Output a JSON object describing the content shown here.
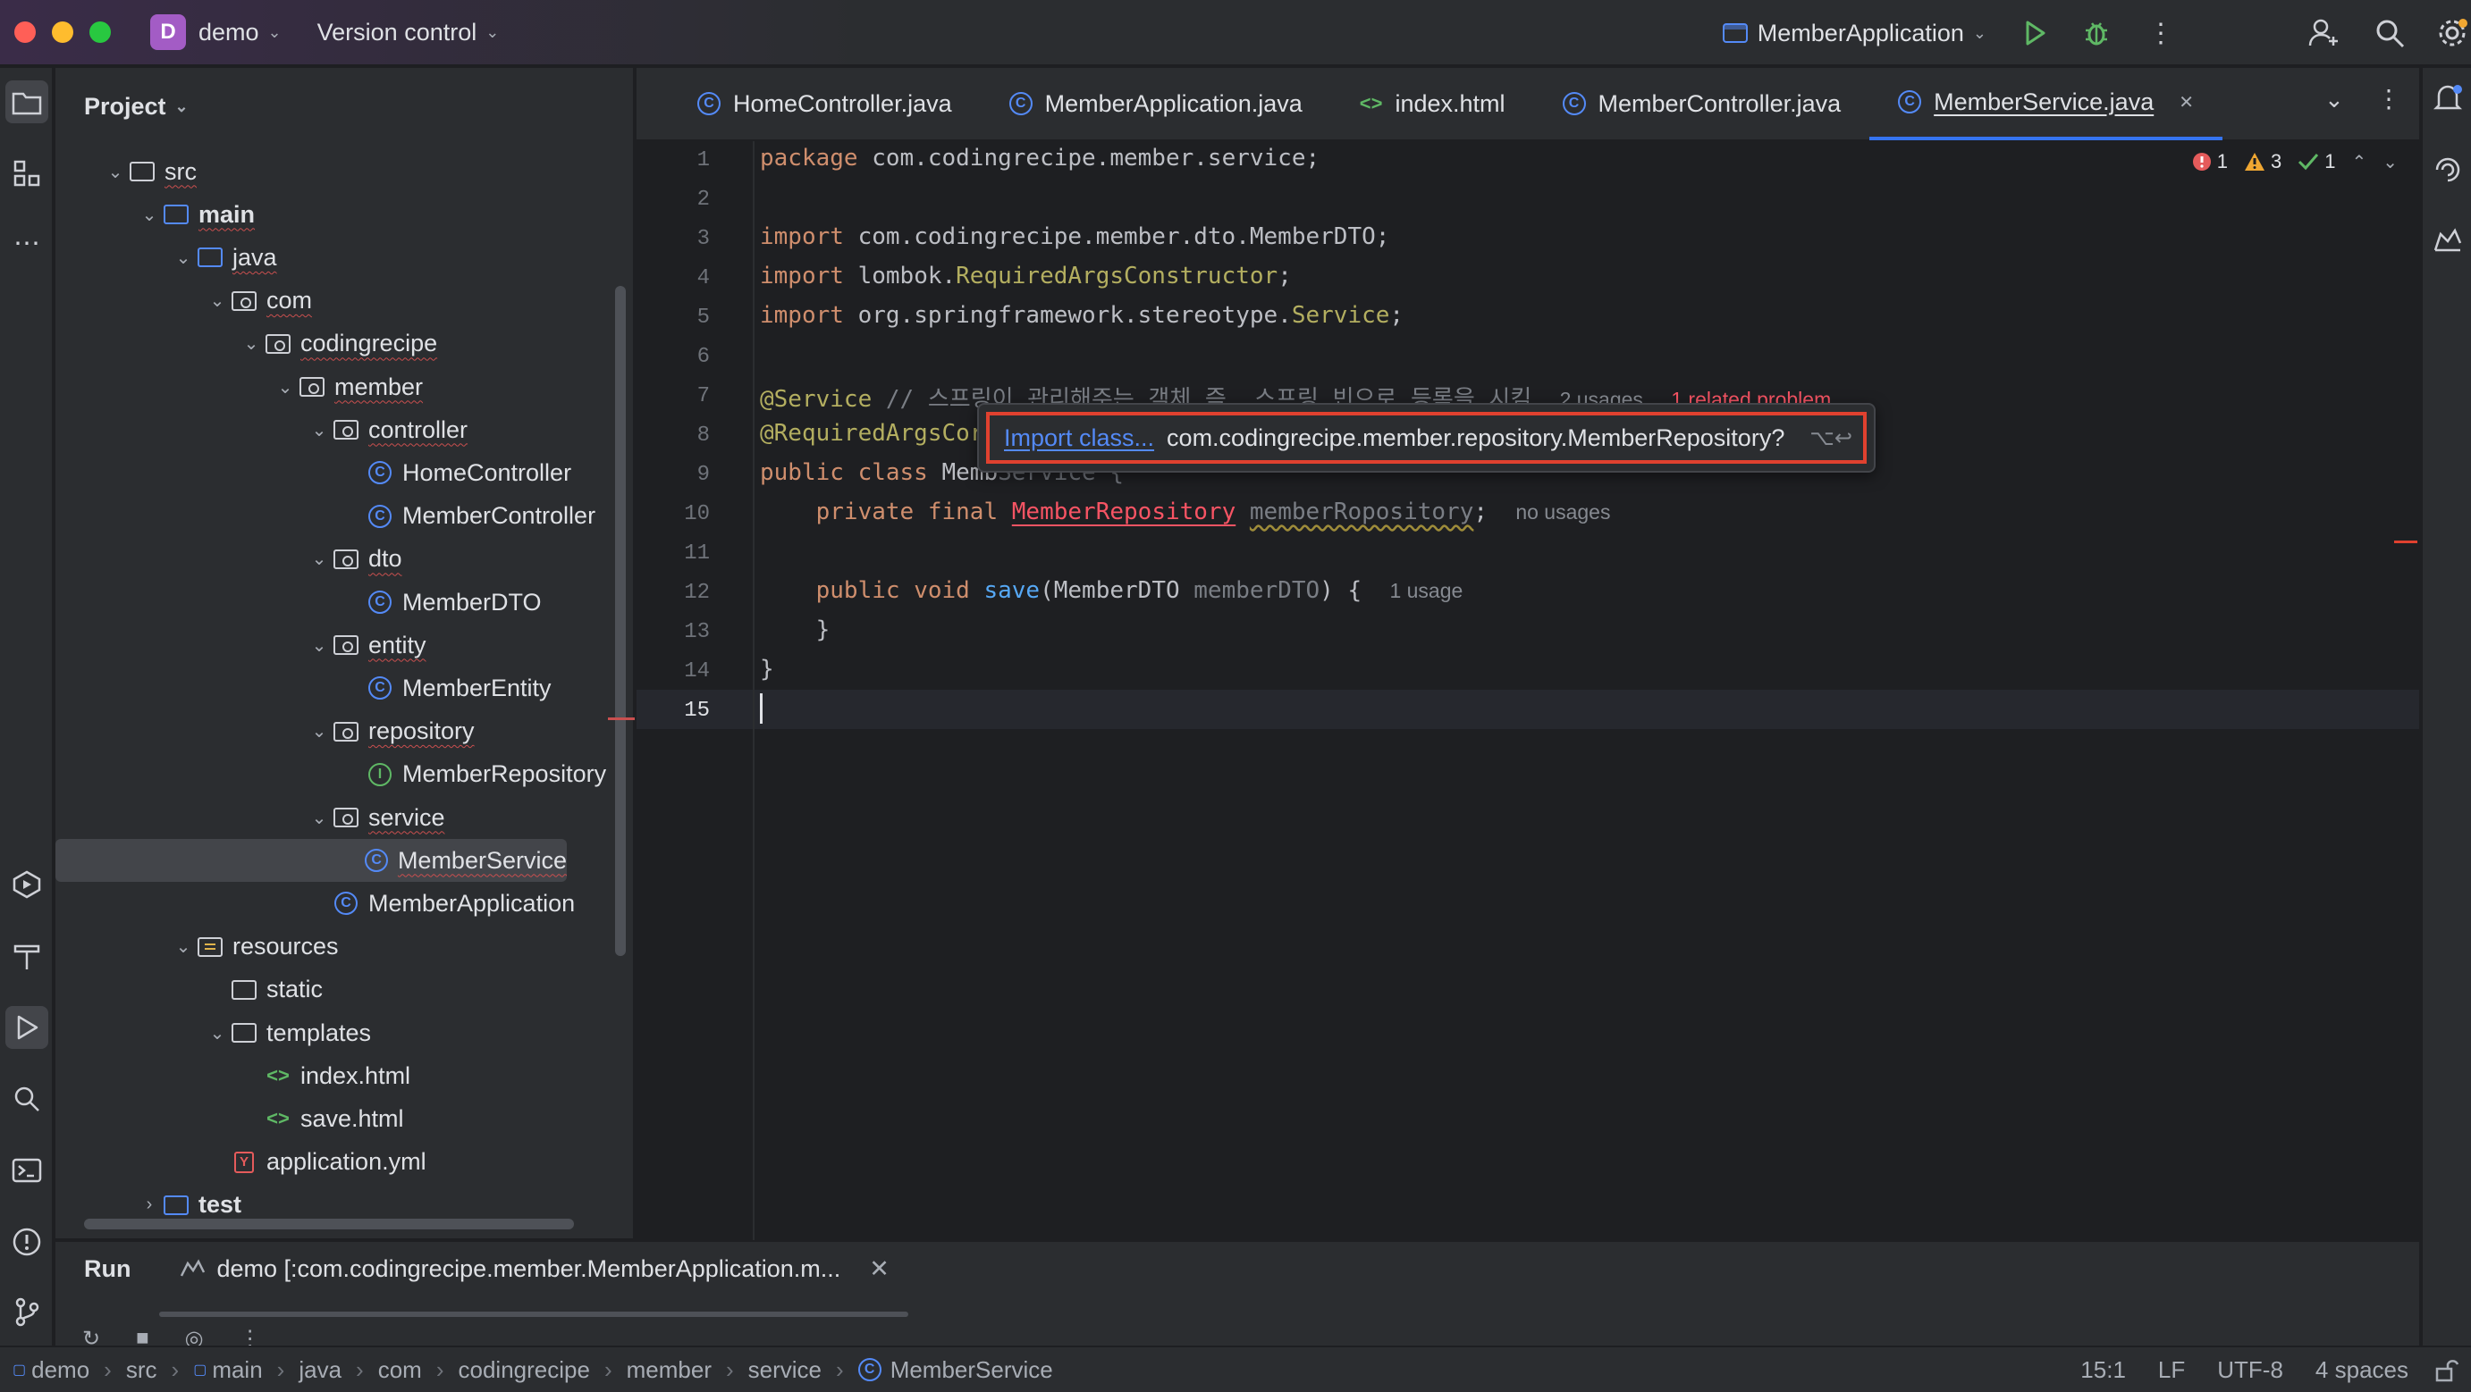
{
  "titlebar": {
    "project_badge": "D",
    "project_name": "demo",
    "vcs": "Version control",
    "run_config": "MemberApplication"
  },
  "project_panel": {
    "title": "Project",
    "tree": [
      {
        "label": "src",
        "kind": "folder",
        "depth": 0,
        "expanded": true
      },
      {
        "label": "main",
        "kind": "folder-src",
        "depth": 1,
        "expanded": true,
        "bold": true
      },
      {
        "label": "java",
        "kind": "folder-src",
        "depth": 2,
        "expanded": true
      },
      {
        "label": "com",
        "kind": "package",
        "depth": 3,
        "expanded": true
      },
      {
        "label": "codingrecipe",
        "kind": "package",
        "depth": 4,
        "expanded": true
      },
      {
        "label": "member",
        "kind": "package",
        "depth": 5,
        "expanded": true
      },
      {
        "label": "controller",
        "kind": "package",
        "depth": 6,
        "expanded": true
      },
      {
        "label": "HomeController",
        "kind": "class",
        "depth": 7
      },
      {
        "label": "MemberController",
        "kind": "class",
        "depth": 7
      },
      {
        "label": "dto",
        "kind": "package",
        "depth": 6,
        "expanded": true
      },
      {
        "label": "MemberDTO",
        "kind": "class",
        "depth": 7
      },
      {
        "label": "entity",
        "kind": "package",
        "depth": 6,
        "expanded": true
      },
      {
        "label": "MemberEntity",
        "kind": "class",
        "depth": 7
      },
      {
        "label": "repository",
        "kind": "package",
        "depth": 6,
        "expanded": true
      },
      {
        "label": "MemberRepository",
        "kind": "interface",
        "depth": 7
      },
      {
        "label": "service",
        "kind": "package",
        "depth": 6,
        "expanded": true
      },
      {
        "label": "MemberService",
        "kind": "class",
        "depth": 7,
        "selected": true
      },
      {
        "label": "MemberApplication",
        "kind": "app",
        "depth": 6
      },
      {
        "label": "resources",
        "kind": "folder-res",
        "depth": 2,
        "expanded": true
      },
      {
        "label": "static",
        "kind": "folder",
        "depth": 3
      },
      {
        "label": "templates",
        "kind": "folder",
        "depth": 3,
        "expanded": true
      },
      {
        "label": "index.html",
        "kind": "html",
        "depth": 4
      },
      {
        "label": "save.html",
        "kind": "html",
        "depth": 4
      },
      {
        "label": "application.yml",
        "kind": "yml",
        "depth": 3
      },
      {
        "label": "test",
        "kind": "folder-src",
        "depth": 1,
        "expanded": false,
        "bold": true
      }
    ]
  },
  "tabs": [
    {
      "label": "HomeController.java",
      "icon": "class-icon"
    },
    {
      "label": "MemberApplication.java",
      "icon": "app-icon"
    },
    {
      "label": "index.html",
      "icon": "html-icon"
    },
    {
      "label": "MemberController.java",
      "icon": "class-icon"
    },
    {
      "label": "MemberService.java",
      "icon": "class-icon",
      "active": true
    }
  ],
  "editor": {
    "inspections": {
      "errors": "1",
      "warnings": "3",
      "ok": "1"
    },
    "current_line": "15",
    "lines": {
      "l1": {
        "a": "package",
        "b": " com.codingrecipe.member.service;"
      },
      "l3": {
        "a": "import",
        "b": " com.codingrecipe.member.dto.MemberDTO;"
      },
      "l4": {
        "a": "import",
        "b": " lombok.",
        "c": "RequiredArgsConstructor",
        "d": ";"
      },
      "l5": {
        "a": "import",
        "b": " org.springframework.stereotype.",
        "c": "Service",
        "d": ";"
      },
      "l7": {
        "a": "@Service",
        "b": " // 스프링이 관리해주는 객체 즉, 스프링 빈으로 등록을 시킴",
        "c": "2 usages",
        "d": "1 related problem"
      },
      "l8": {
        "a": "@RequiredArgsCor"
      },
      "l9": {
        "a": "public class",
        "b": " Memb",
        "c": "Service {"
      },
      "l10": {
        "a": "private final",
        "b": "MemberRepository",
        "c": "memberRopository",
        "d": ";",
        "e": "no usages"
      },
      "l12": {
        "a": "public void",
        "b": "save",
        "c": "(MemberDTO ",
        "d": "memberDTO",
        "e": ") {",
        "f": "1 usage"
      },
      "l13": {
        "a": "}"
      },
      "l14": {
        "a": "}"
      }
    }
  },
  "popup": {
    "link": "Import class...",
    "text": "com.codingrecipe.member.repository.MemberRepository?",
    "keys": "⌥↩"
  },
  "run_panel": {
    "title": "Run",
    "tab": "demo [:com.codingrecipe.member.MemberApplication.m..."
  },
  "statusbar": {
    "crumbs": [
      "demo",
      "src",
      "main",
      "java",
      "com",
      "codingrecipe",
      "member",
      "service",
      "MemberService"
    ],
    "position": "15:1",
    "line_sep": "LF",
    "encoding": "UTF-8",
    "indent": "4 spaces"
  },
  "colors": {
    "accent": "#3574f0",
    "error": "#f75464",
    "highlight_box": "#e0412f"
  }
}
